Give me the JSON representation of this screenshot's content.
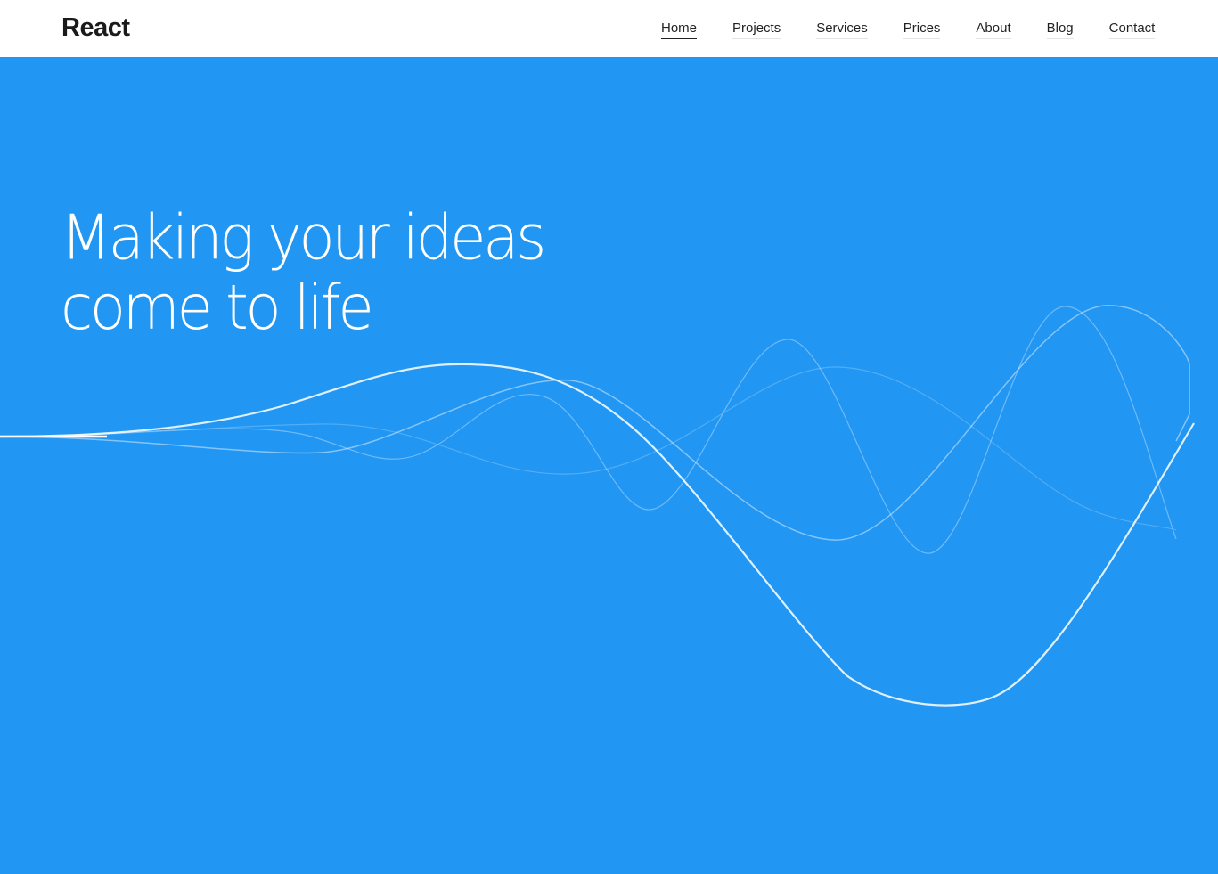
{
  "header": {
    "logo": "React",
    "nav": [
      {
        "label": "Home",
        "active": true
      },
      {
        "label": "Projects",
        "active": false
      },
      {
        "label": "Services",
        "active": false
      },
      {
        "label": "Prices",
        "active": false
      },
      {
        "label": "About",
        "active": false
      },
      {
        "label": "Blog",
        "active": false
      },
      {
        "label": "Contact",
        "active": false
      }
    ]
  },
  "hero": {
    "title_line1": "Making your ideas",
    "title_line2": "come to life",
    "background_color": "#2196f3",
    "text_color": "#ffffff"
  }
}
